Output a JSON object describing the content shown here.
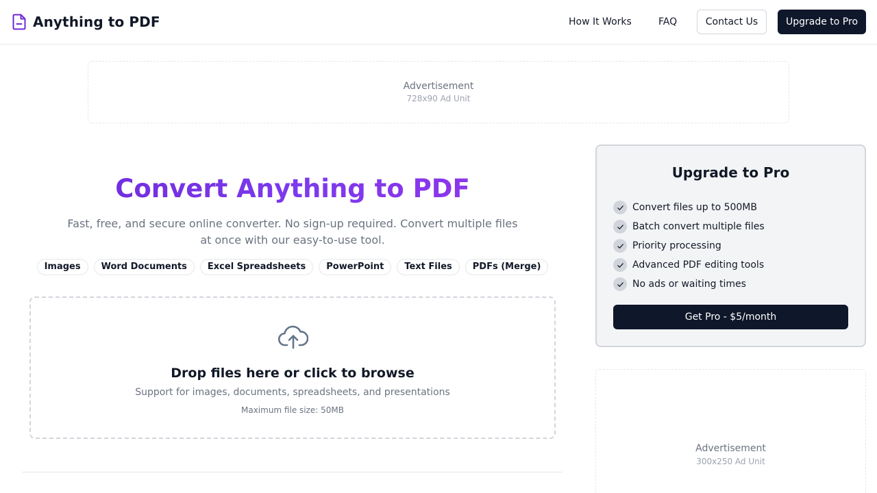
{
  "header": {
    "brand_icon": "document-icon",
    "title": "Anything to PDF",
    "nav": {
      "how_it_works": "How It Works",
      "faq": "FAQ",
      "contact": "Contact Us",
      "upgrade": "Upgrade to Pro"
    }
  },
  "ad_top": {
    "label": "Advertisement",
    "size": "728x90 Ad Unit"
  },
  "hero": {
    "title": "Convert Anything to PDF",
    "subtitle": "Fast, free, and secure online converter. No sign-up required. Convert multiple files at once with our easy-to-use tool.",
    "formats": [
      "Images",
      "Word Documents",
      "Excel Spreadsheets",
      "PowerPoint",
      "Text Files",
      "PDFs (Merge)"
    ]
  },
  "dropzone": {
    "icon": "cloud-upload-icon",
    "title": "Drop files here or click to browse",
    "subtitle": "Support for images, documents, spreadsheets, and presentations",
    "max_size": "Maximum file size: 50MB"
  },
  "pro": {
    "title": "Upgrade to Pro",
    "features": [
      "Convert files up to 500MB",
      "Batch convert multiple files",
      "Priority processing",
      "Advanced PDF editing tools",
      "No ads or waiting times"
    ],
    "button": "Get Pro - $5/month"
  },
  "ad_side": {
    "label": "Advertisement",
    "size": "300x250 Ad Unit"
  },
  "colors": {
    "accent_purple": "#7c3aed",
    "dark_button": "#0f172a",
    "muted_text": "#6b7280"
  }
}
